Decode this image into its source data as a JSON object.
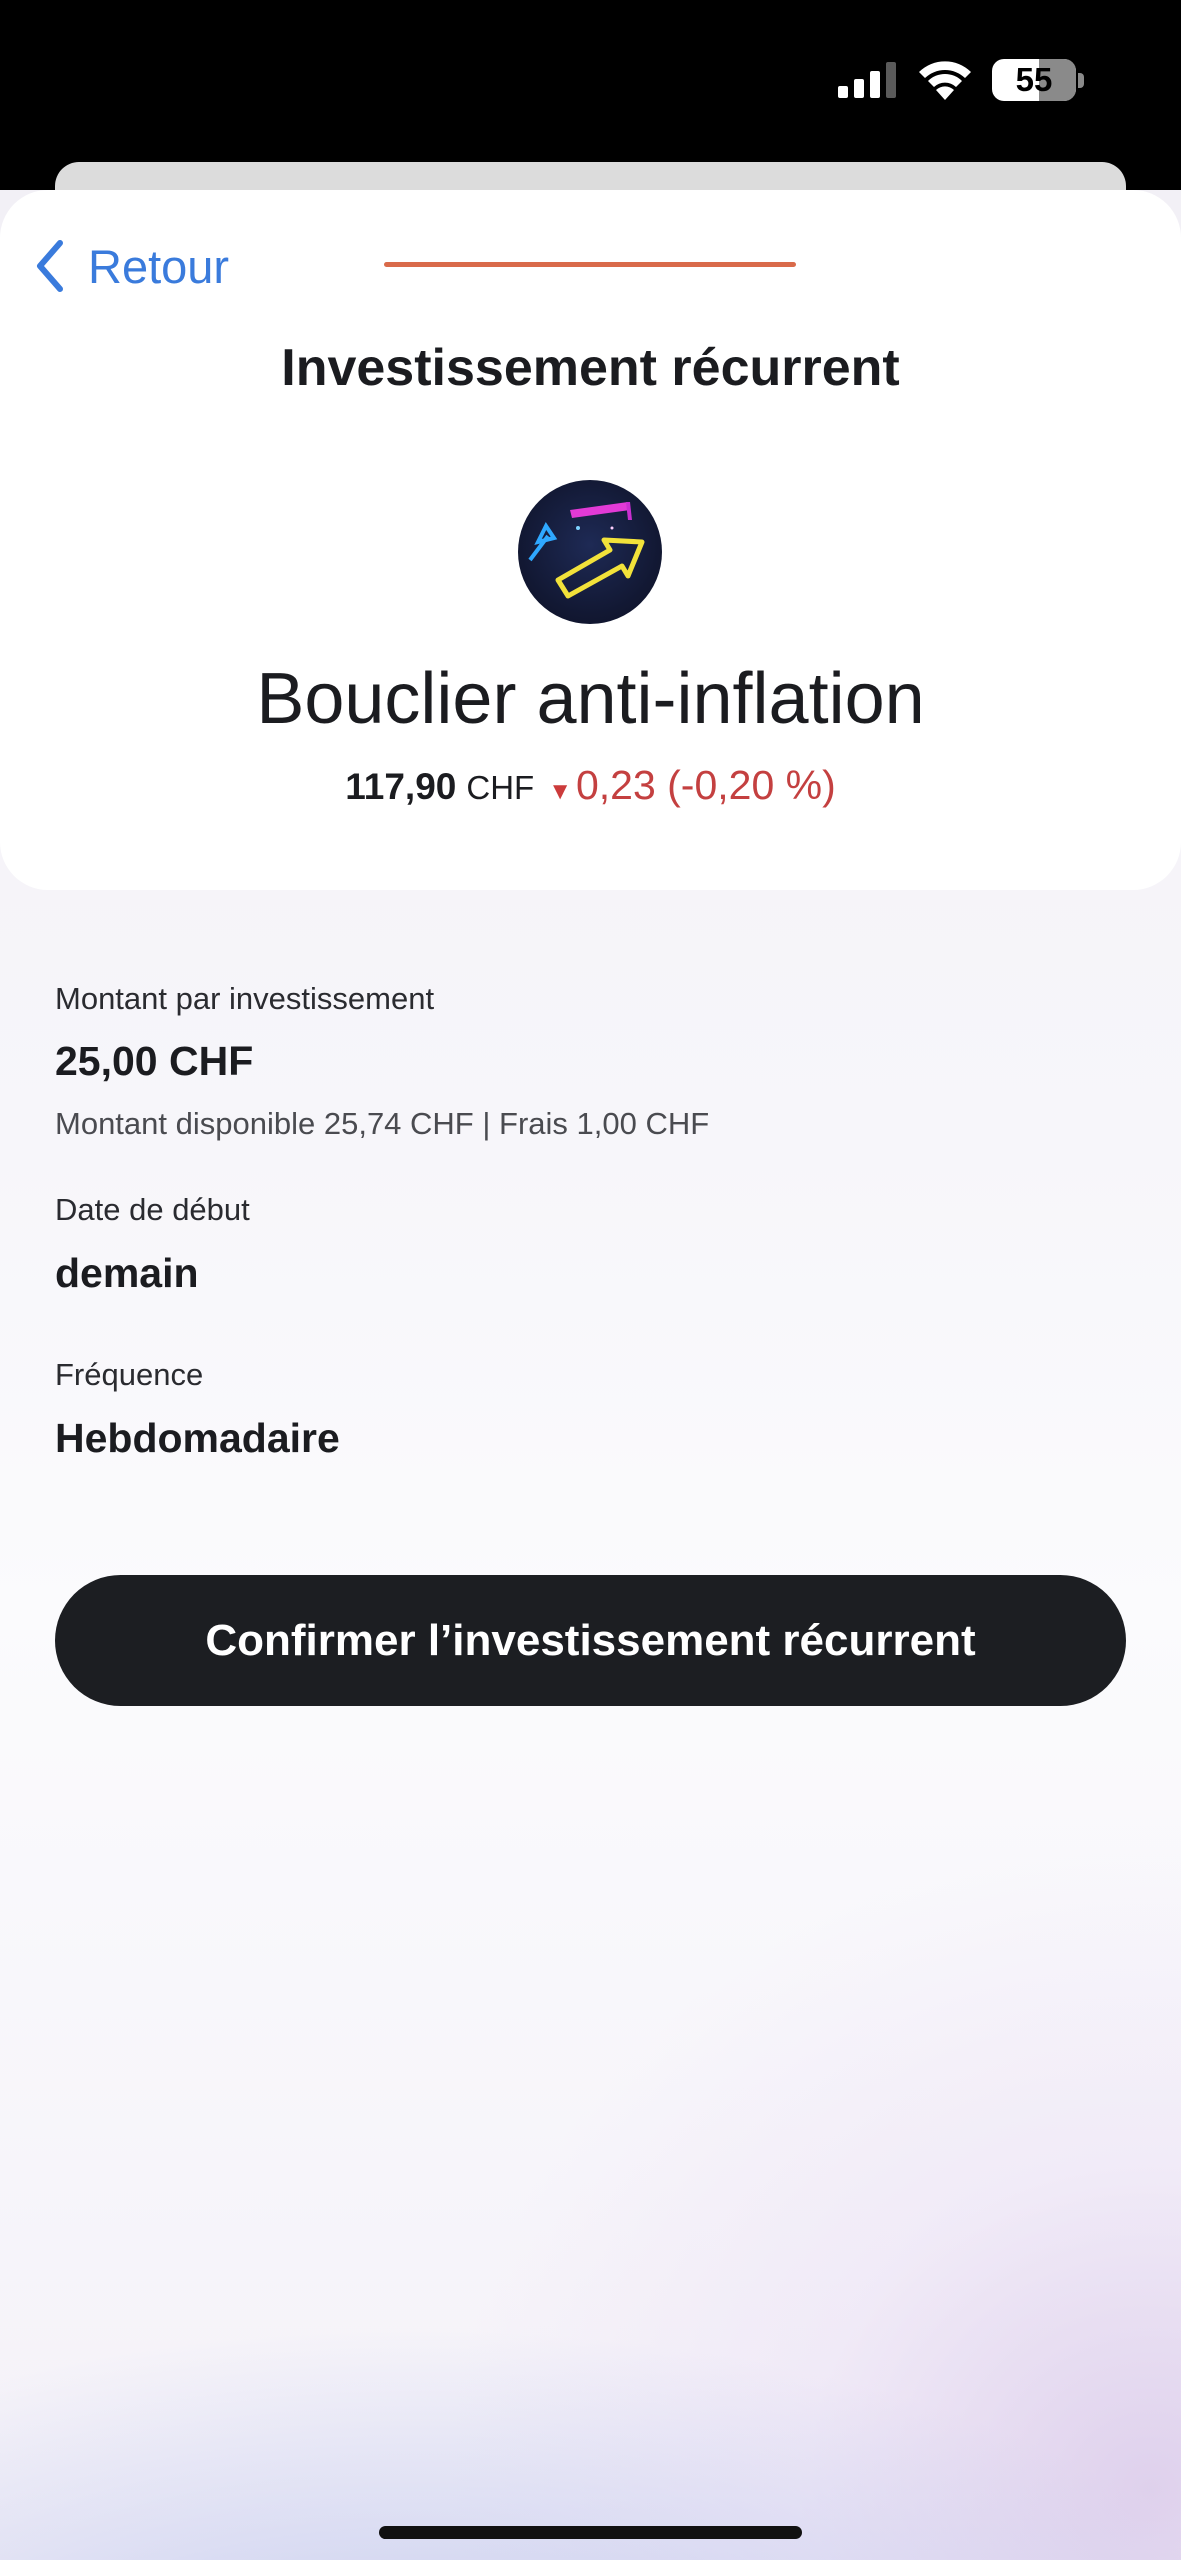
{
  "status_bar": {
    "battery_level": "55",
    "icons": [
      "cellular-signal-icon",
      "wifi-icon",
      "battery-icon"
    ]
  },
  "nav": {
    "back_label": "Retour",
    "progress_color": "#d96a4a"
  },
  "header": {
    "title": "Investissement récurrent",
    "product_name": "Bouclier anti-inflation",
    "logo_icon": "neon-arrow-logo-icon",
    "price": {
      "value": "117,90",
      "currency": "CHF",
      "change_direction": "down",
      "change_text": "0,23 (-0,20 %)"
    }
  },
  "form": {
    "amount": {
      "label": "Montant par investissement",
      "value": "25,00 CHF",
      "hint": "Montant disponible 25,74 CHF | Frais 1,00 CHF"
    },
    "start_date": {
      "label": "Date de début",
      "value": "demain"
    },
    "frequency": {
      "label": "Fréquence",
      "value": "Hebdomadaire"
    }
  },
  "actions": {
    "confirm_label": "Confirmer l’investissement récurrent"
  },
  "colors": {
    "accent_link": "#3a7bdc",
    "negative": "#c44040",
    "button_bg": "#1c1e22"
  }
}
